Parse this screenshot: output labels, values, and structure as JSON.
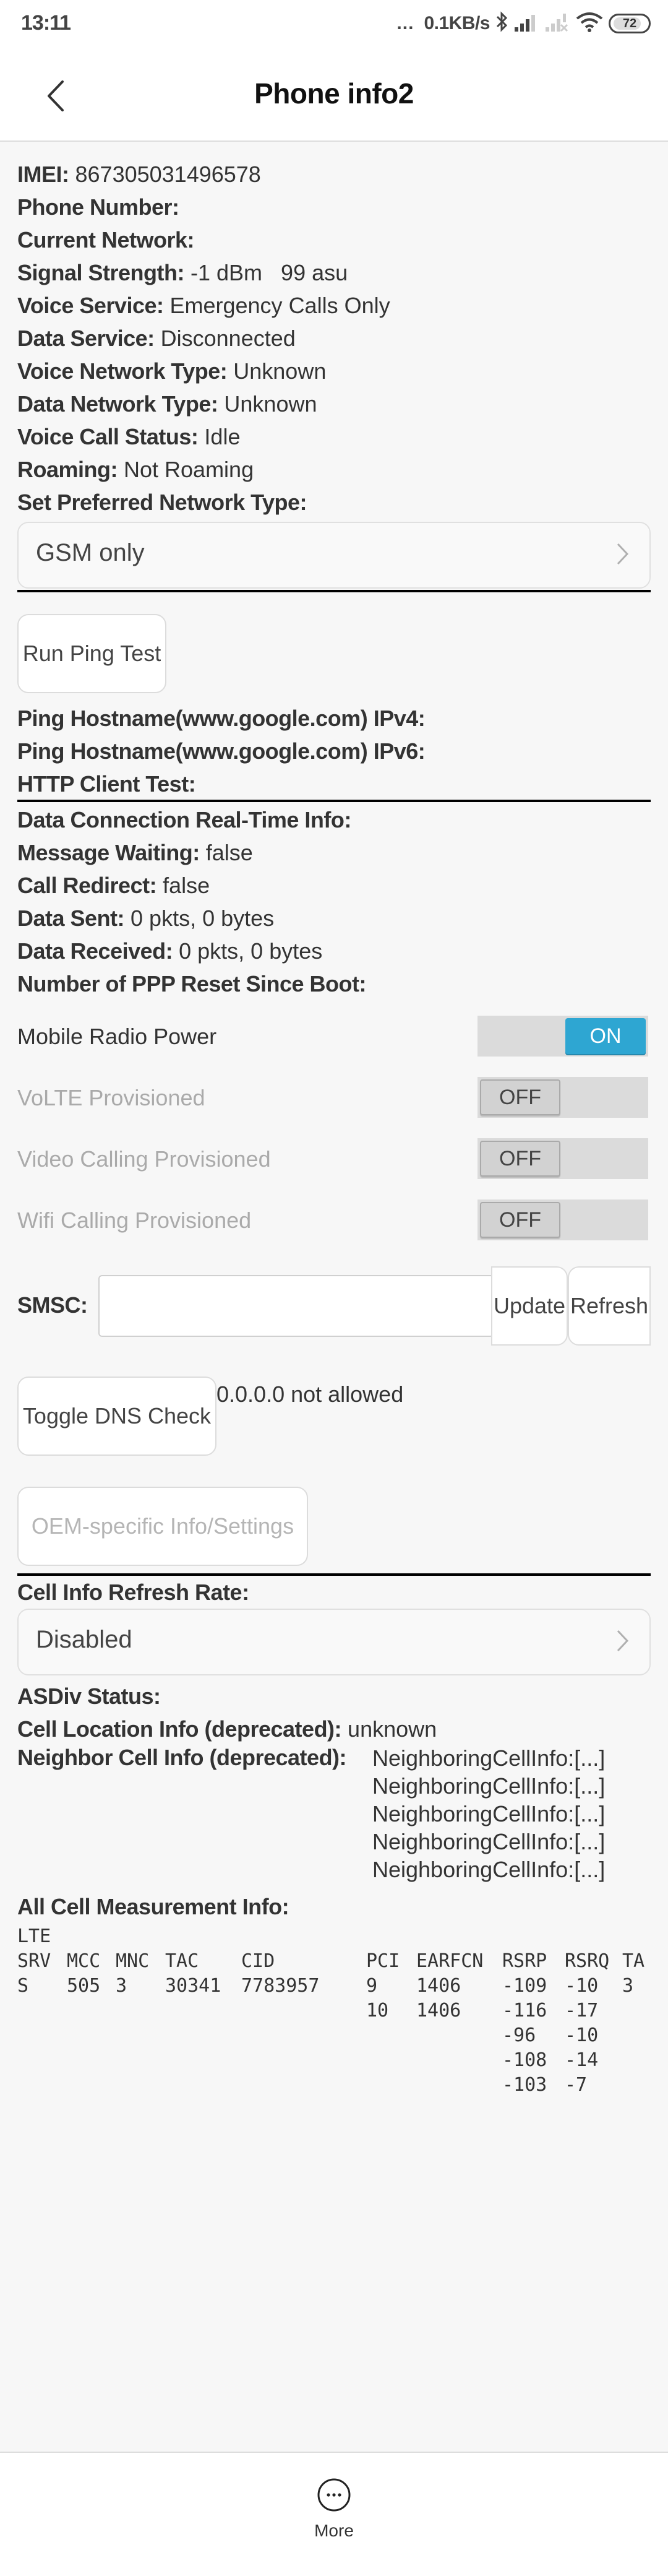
{
  "status_bar": {
    "time": "13:11",
    "overflow": "...",
    "net_speed": "0.1KB/s",
    "icons": [
      "bluetooth-icon",
      "signal-icon",
      "signal-no-sim-icon",
      "wifi-icon",
      "battery-icon"
    ],
    "battery": "72"
  },
  "header": {
    "back_icon": "chevron-left-icon",
    "title": "Phone info2"
  },
  "info": {
    "imei": {
      "label": "IMEI:",
      "value": " 867305031496578"
    },
    "phone_number": {
      "label": "Phone Number:",
      "value": ""
    },
    "current_network": {
      "label": "Current Network:",
      "value": ""
    },
    "signal_strength": {
      "label": "Signal Strength:",
      "value": " -1 dBm   99 asu"
    },
    "voice_service": {
      "label": "Voice Service:",
      "value": " Emergency Calls Only"
    },
    "data_service": {
      "label": "Data Service:",
      "value": " Disconnected"
    },
    "voice_network_type": {
      "label": "Voice Network Type:",
      "value": " Unknown"
    },
    "data_network_type": {
      "label": "Data Network Type:",
      "value": " Unknown"
    },
    "voice_call_status": {
      "label": "Voice Call Status:",
      "value": " Idle"
    },
    "roaming": {
      "label": "Roaming:",
      "value": " Not Roaming"
    },
    "preferred_network_label": "Set Preferred Network Type:"
  },
  "preferred_network": {
    "selected": "GSM only",
    "chevron_icon": "chevron-right-icon"
  },
  "ping": {
    "button": "Run Ping Test",
    "ipv4_label": "Ping Hostname(www.google.com) IPv4:",
    "ipv6_label": "Ping Hostname(www.google.com) IPv6:",
    "http_label": "HTTP Client Test:"
  },
  "data_conn": {
    "realtime_label": "Data Connection Real-Time Info:",
    "message_waiting": {
      "label": "Message Waiting:",
      "value": " false"
    },
    "call_redirect": {
      "label": "Call Redirect:",
      "value": " false"
    },
    "data_sent": {
      "label": "Data Sent:",
      "value": " 0 pkts, 0 bytes"
    },
    "data_received": {
      "label": "Data Received:",
      "value": " 0 pkts, 0 bytes"
    },
    "ppp_reset_label": "Number of PPP Reset Since Boot:"
  },
  "switches": [
    {
      "label": "Mobile Radio Power",
      "state": "ON",
      "enabled": true
    },
    {
      "label": "VoLTE Provisioned",
      "state": "OFF",
      "enabled": false
    },
    {
      "label": "Video Calling Provisioned",
      "state": "OFF",
      "enabled": false
    },
    {
      "label": "Wifi Calling Provisioned",
      "state": "OFF",
      "enabled": false
    }
  ],
  "smsc": {
    "label": "SMSC:",
    "value": "",
    "update_button": "Update",
    "refresh_button": "Refresh"
  },
  "dns": {
    "button": "Toggle DNS Check",
    "status": "0.0.0.0 not allowed"
  },
  "oem": {
    "button": "OEM-specific Info/Settings"
  },
  "cell_refresh": {
    "label": "Cell Info Refresh Rate:",
    "selected": "Disabled"
  },
  "cell_info": {
    "asdiv_label": "ASDiv Status:",
    "cell_location": {
      "label": "Cell Location Info (deprecated):",
      "value": " unknown"
    },
    "neighbor_label": "Neighbor Cell Info (deprecated):",
    "neighbors": [
      "NeighboringCellInfo:[...]",
      "NeighboringCellInfo:[...]",
      "NeighboringCellInfo:[...]",
      "NeighboringCellInfo:[...]",
      "NeighboringCellInfo:[...]"
    ],
    "measurement_label": "All Cell Measurement Info:",
    "measurement": {
      "rat": "LTE",
      "columns": [
        "SRV",
        "MCC",
        "MNC",
        "TAC",
        "CID",
        "PCI",
        "EARFCN",
        "RSRP",
        "RSRQ",
        "TA"
      ],
      "rows": [
        {
          "SRV": "S",
          "MCC": "505",
          "MNC": "3",
          "TAC": "30341",
          "CID": "7783957",
          "PCI": "9",
          "EARFCN": "1406",
          "RSRP": "-109",
          "RSRQ": "-10",
          "TA": "3"
        },
        {
          "SRV": "",
          "MCC": "",
          "MNC": "",
          "TAC": "",
          "CID": "",
          "PCI": "10",
          "EARFCN": "1406",
          "RSRP": "-116",
          "RSRQ": "-17",
          "TA": ""
        },
        {
          "SRV": "",
          "MCC": "",
          "MNC": "",
          "TAC": "",
          "CID": "",
          "PCI": "",
          "EARFCN": "",
          "RSRP": "-96",
          "RSRQ": "-10",
          "TA": ""
        },
        {
          "SRV": "",
          "MCC": "",
          "MNC": "",
          "TAC": "",
          "CID": "",
          "PCI": "",
          "EARFCN": "",
          "RSRP": "-108",
          "RSRQ": "-14",
          "TA": ""
        },
        {
          "SRV": "",
          "MCC": "",
          "MNC": "",
          "TAC": "",
          "CID": "",
          "PCI": "",
          "EARFCN": "",
          "RSRP": "-103",
          "RSRQ": "-7",
          "TA": ""
        }
      ]
    }
  },
  "bottom_bar": {
    "more_icon": "more-icon",
    "more_label": "More"
  },
  "colors": {
    "switch_on": "#2ea6d2",
    "background": "#f7f7f7"
  }
}
